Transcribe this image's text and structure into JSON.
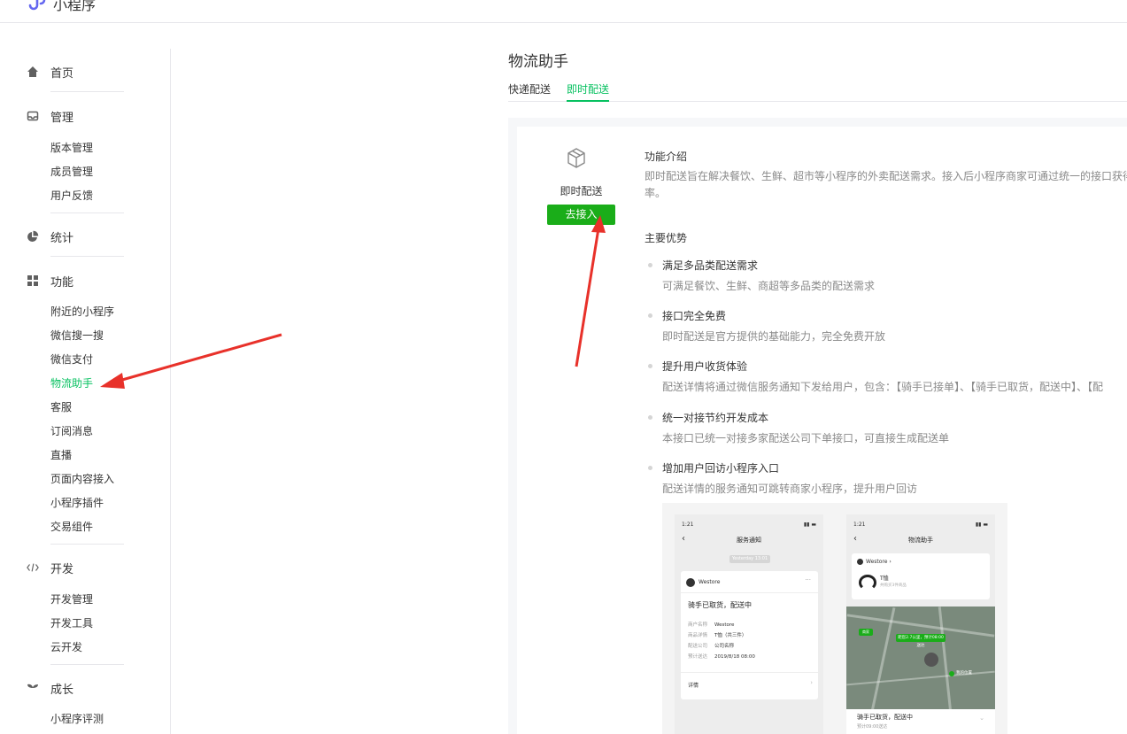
{
  "app": {
    "name": "小程序"
  },
  "sidebar": {
    "sections": [
      {
        "label": "首页",
        "icon": "home-icon",
        "items": []
      },
      {
        "label": "管理",
        "icon": "inbox-icon",
        "items": [
          "版本管理",
          "成员管理",
          "用户反馈"
        ]
      },
      {
        "label": "统计",
        "icon": "pie-chart-icon",
        "items": []
      },
      {
        "label": "功能",
        "icon": "grid-icon",
        "items": [
          "附近的小程序",
          "微信搜一搜",
          "微信支付",
          "物流助手",
          "客服",
          "订阅消息",
          "直播",
          "页面内容接入",
          "小程序插件",
          "交易组件"
        ]
      },
      {
        "label": "开发",
        "icon": "code-icon",
        "items": [
          "开发管理",
          "开发工具",
          "云开发"
        ]
      },
      {
        "label": "成长",
        "icon": "sprout-icon",
        "items": [
          "小程序评测"
        ]
      }
    ],
    "active_item": "物流助手"
  },
  "page": {
    "title": "物流助手",
    "tabs": [
      {
        "label": "快递配送",
        "active": false
      },
      {
        "label": "即时配送",
        "active": true
      }
    ]
  },
  "service": {
    "name": "即时配送",
    "icon": "box-icon",
    "button": "去接入"
  },
  "intro": {
    "title": "功能介绍",
    "line1": "即时配送旨在解决餐饮、生鲜、超市等小程序的外卖配送需求。接入后小程序商家可通过统一的接口获得",
    "line2": "率。"
  },
  "advantages": {
    "title": "主要优势",
    "items": [
      {
        "title": "满足多品类配送需求",
        "desc": "可满足餐饮、生鲜、商超等多品类的配送需求"
      },
      {
        "title": "接口完全免费",
        "desc": "即时配送是官方提供的基础能力，完全免费开放"
      },
      {
        "title": "提升用户收货体验",
        "desc": "配送详情将通过微信服务通知下发给用户，包含：【骑手已接单】、【骑手已取货，配送中】、【配"
      },
      {
        "title": "统一对接节约开发成本",
        "desc": "本接口已统一对接多家配送公司下单接口，可直接生成配送单"
      },
      {
        "title": "增加用户回访小程序入口",
        "desc": "配送详情的服务通知可跳转商家小程序，提升用户回访"
      }
    ]
  },
  "preview": {
    "phone1": {
      "time": "1:21",
      "title": "服务通知",
      "date_chip": "Yesterday 13:01",
      "brand": "Westore",
      "headline": "骑手已取货，配送中",
      "rows": [
        {
          "k": "商户名称",
          "v": "Westore"
        },
        {
          "k": "商品详情",
          "v": "T恤（共三件）"
        },
        {
          "k": "配送公司",
          "v": "公司名称"
        },
        {
          "k": "预计送达",
          "v": "2019/8/18  08:00"
        }
      ],
      "detail": "详情"
    },
    "phone2": {
      "time": "1:21",
      "title": "物流助手",
      "brand": "Westore",
      "item_name": "T恤",
      "item_sub": "共购买3件商品",
      "map_tag": "距您2.7公里，预计08:00送达",
      "pin1": "商家",
      "pin2": "我的位置",
      "rider_status": "骑手已取货，配送中",
      "rider_eta": "预计09:00送达"
    }
  }
}
